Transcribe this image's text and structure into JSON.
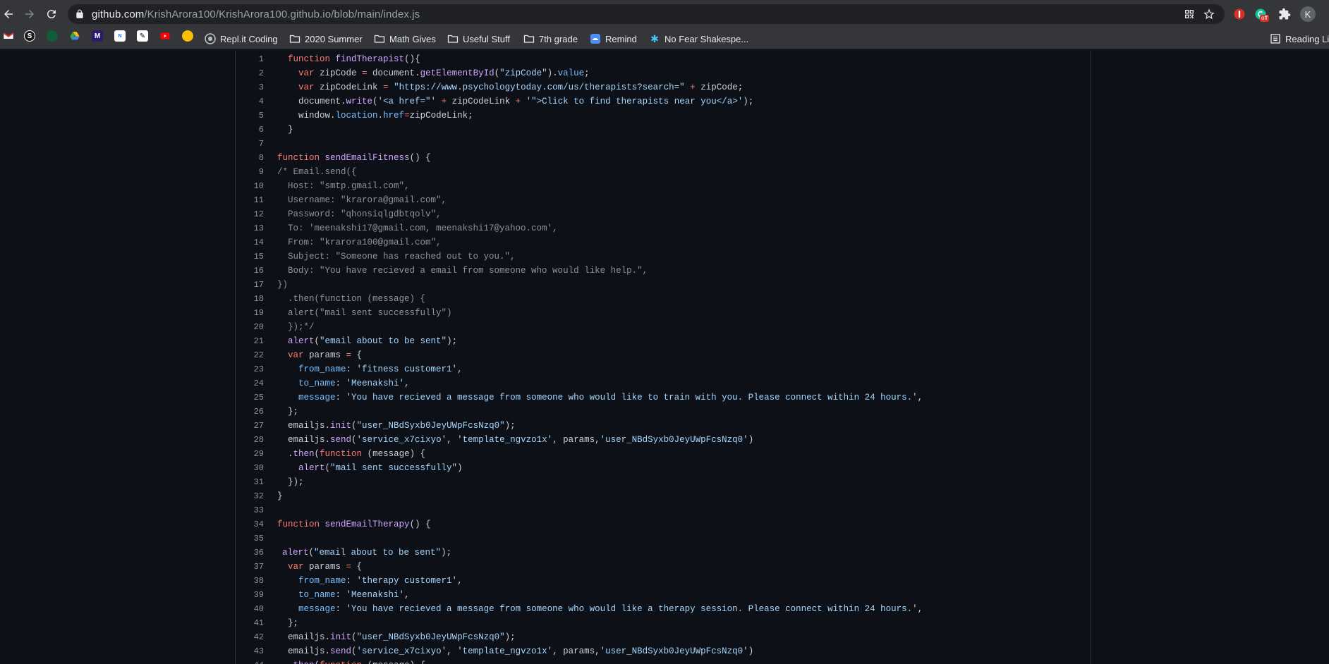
{
  "browser": {
    "url_host": "github.com",
    "url_path": "/KrishArora100/KrishArora100.github.io/blob/main/index.js",
    "profile_initial": "K",
    "extension_badge": "off",
    "bookmarks": [
      {
        "label": "Repl.it Coding",
        "icon": "replit-icon"
      },
      {
        "label": "2020 Summer",
        "icon": "folder-icon"
      },
      {
        "label": "Math Gives",
        "icon": "folder-icon"
      },
      {
        "label": "Useful Stuff",
        "icon": "folder-icon"
      },
      {
        "label": "7th grade",
        "icon": "folder-icon"
      },
      {
        "label": "Remind",
        "icon": "remind-icon"
      },
      {
        "label": "No Fear Shakespe...",
        "icon": "snowflake-icon"
      }
    ],
    "reading_list": "Reading Li"
  },
  "colors": {
    "keyword": "#ff7b72",
    "function": "#d2a8ff",
    "string": "#a5d6ff",
    "property": "#79c0ff",
    "comment": "#8b949e",
    "plain": "#c9d1d9"
  },
  "code": {
    "lines": [
      {
        "n": "1",
        "indent": 1,
        "tokens": [
          [
            "kw",
            "function"
          ],
          [
            "pl",
            " "
          ],
          [
            "fn",
            "findTherapist"
          ],
          [
            "pl",
            "(){"
          ]
        ]
      },
      {
        "n": "2",
        "indent": 2,
        "tokens": [
          [
            "kw",
            "var"
          ],
          [
            "pl",
            " zipCode "
          ],
          [
            "kw",
            "="
          ],
          [
            "pl",
            " document."
          ],
          [
            "fn",
            "getElementById"
          ],
          [
            "pl",
            "("
          ],
          [
            "str",
            "\"zipCode\""
          ],
          [
            "pl",
            ")."
          ],
          [
            "prop",
            "value"
          ],
          [
            "pl",
            ";"
          ]
        ]
      },
      {
        "n": "3",
        "indent": 2,
        "tokens": [
          [
            "kw",
            "var"
          ],
          [
            "pl",
            " zipCodeLink "
          ],
          [
            "kw",
            "="
          ],
          [
            "pl",
            " "
          ],
          [
            "str",
            "\"https://www.psychologytoday.com/us/therapists?search=\""
          ],
          [
            "pl",
            " "
          ],
          [
            "kw",
            "+"
          ],
          [
            "pl",
            " zipCode;"
          ]
        ]
      },
      {
        "n": "4",
        "indent": 2,
        "tokens": [
          [
            "pl",
            "document."
          ],
          [
            "fn",
            "write"
          ],
          [
            "pl",
            "("
          ],
          [
            "str",
            "'<a href=\"'"
          ],
          [
            "pl",
            " "
          ],
          [
            "kw",
            "+"
          ],
          [
            "pl",
            " zipCodeLink "
          ],
          [
            "kw",
            "+"
          ],
          [
            "pl",
            " "
          ],
          [
            "str",
            "'\">Click to find therapists near you</a>'"
          ],
          [
            "pl",
            ");"
          ]
        ]
      },
      {
        "n": "5",
        "indent": 2,
        "tokens": [
          [
            "pl",
            "window."
          ],
          [
            "prop",
            "location"
          ],
          [
            "pl",
            "."
          ],
          [
            "prop",
            "href"
          ],
          [
            "kw",
            "="
          ],
          [
            "pl",
            "zipCodeLink;"
          ]
        ]
      },
      {
        "n": "6",
        "indent": 1,
        "tokens": [
          [
            "pl",
            "}"
          ]
        ]
      },
      {
        "n": "7",
        "indent": 0,
        "tokens": []
      },
      {
        "n": "8",
        "indent": 0,
        "tokens": [
          [
            "kw",
            "function"
          ],
          [
            "pl",
            " "
          ],
          [
            "fn",
            "sendEmailFitness"
          ],
          [
            "pl",
            "() {"
          ]
        ]
      },
      {
        "n": "9",
        "indent": 0,
        "tokens": [
          [
            "cm",
            "/* Email.send({"
          ]
        ]
      },
      {
        "n": "10",
        "indent": 1,
        "tokens": [
          [
            "cm",
            "Host: \"smtp.gmail.com\","
          ]
        ]
      },
      {
        "n": "11",
        "indent": 1,
        "tokens": [
          [
            "cm",
            "Username: \"krarora@gmail.com\","
          ]
        ]
      },
      {
        "n": "12",
        "indent": 1,
        "tokens": [
          [
            "cm",
            "Password: \"qhonsiqlgdbtqolv\","
          ]
        ]
      },
      {
        "n": "13",
        "indent": 1,
        "tokens": [
          [
            "cm",
            "To: 'meenakshi17@gmail.com, meenakshi17@yahoo.com',"
          ]
        ]
      },
      {
        "n": "14",
        "indent": 1,
        "tokens": [
          [
            "cm",
            "From: \"krarora100@gmail.com\","
          ]
        ]
      },
      {
        "n": "15",
        "indent": 1,
        "tokens": [
          [
            "cm",
            "Subject: \"Someone has reached out to you.\","
          ]
        ]
      },
      {
        "n": "16",
        "indent": 1,
        "tokens": [
          [
            "cm",
            "Body: \"You have recieved a email from someone who would like help.\","
          ]
        ]
      },
      {
        "n": "17",
        "indent": 0,
        "tokens": [
          [
            "cm",
            "})"
          ]
        ]
      },
      {
        "n": "18",
        "indent": 1,
        "tokens": [
          [
            "cm",
            ".then(function (message) {"
          ]
        ]
      },
      {
        "n": "19",
        "indent": 1,
        "tokens": [
          [
            "cm",
            "alert(\"mail sent successfully\")"
          ]
        ]
      },
      {
        "n": "20",
        "indent": 1,
        "tokens": [
          [
            "cm",
            "});*/"
          ]
        ]
      },
      {
        "n": "21",
        "indent": 1,
        "tokens": [
          [
            "fn",
            "alert"
          ],
          [
            "pl",
            "("
          ],
          [
            "str",
            "\"email about to be sent\""
          ],
          [
            "pl",
            ");"
          ]
        ]
      },
      {
        "n": "22",
        "indent": 1,
        "tokens": [
          [
            "kw",
            "var"
          ],
          [
            "pl",
            " params "
          ],
          [
            "kw",
            "="
          ],
          [
            "pl",
            " {"
          ]
        ]
      },
      {
        "n": "23",
        "indent": 2,
        "tokens": [
          [
            "prop",
            "from_name"
          ],
          [
            "pl",
            ": "
          ],
          [
            "str",
            "'fitness customer1'"
          ],
          [
            "pl",
            ","
          ]
        ]
      },
      {
        "n": "24",
        "indent": 2,
        "tokens": [
          [
            "prop",
            "to_name"
          ],
          [
            "pl",
            ": "
          ],
          [
            "str",
            "'Meenakshi'"
          ],
          [
            "pl",
            ","
          ]
        ]
      },
      {
        "n": "25",
        "indent": 2,
        "tokens": [
          [
            "prop",
            "message"
          ],
          [
            "pl",
            ": "
          ],
          [
            "str",
            "'You have recieved a message from someone who would like to train with you. Please connect within 24 hours.'"
          ],
          [
            "pl",
            ","
          ]
        ]
      },
      {
        "n": "26",
        "indent": 1,
        "tokens": [
          [
            "pl",
            "};"
          ]
        ]
      },
      {
        "n": "27",
        "indent": 1,
        "tokens": [
          [
            "pl",
            "emailjs."
          ],
          [
            "fn",
            "init"
          ],
          [
            "pl",
            "("
          ],
          [
            "str",
            "\"user_NBdSyxb0JeyUWpFcsNzq0\""
          ],
          [
            "pl",
            ");"
          ]
        ]
      },
      {
        "n": "28",
        "indent": 1,
        "tokens": [
          [
            "pl",
            "emailjs."
          ],
          [
            "fn",
            "send"
          ],
          [
            "pl",
            "("
          ],
          [
            "str",
            "'service_x7cixyo'"
          ],
          [
            "pl",
            ", "
          ],
          [
            "str",
            "'template_ngvzo1x'"
          ],
          [
            "pl",
            ", params,"
          ],
          [
            "str",
            "'user_NBdSyxb0JeyUWpFcsNzq0'"
          ],
          [
            "pl",
            ")"
          ]
        ]
      },
      {
        "n": "29",
        "indent": 1,
        "tokens": [
          [
            "pl",
            "."
          ],
          [
            "fn",
            "then"
          ],
          [
            "pl",
            "("
          ],
          [
            "kw",
            "function"
          ],
          [
            "pl",
            " (message) {"
          ]
        ]
      },
      {
        "n": "30",
        "indent": 2,
        "tokens": [
          [
            "fn",
            "alert"
          ],
          [
            "pl",
            "("
          ],
          [
            "str",
            "\"mail sent successfully\""
          ],
          [
            "pl",
            ")"
          ]
        ]
      },
      {
        "n": "31",
        "indent": 1,
        "tokens": [
          [
            "pl",
            "});"
          ]
        ]
      },
      {
        "n": "32",
        "indent": 0,
        "tokens": [
          [
            "pl",
            "}"
          ]
        ]
      },
      {
        "n": "33",
        "indent": 0,
        "tokens": []
      },
      {
        "n": "34",
        "indent": 0,
        "tokens": [
          [
            "kw",
            "function"
          ],
          [
            "pl",
            " "
          ],
          [
            "fn",
            "sendEmailTherapy"
          ],
          [
            "pl",
            "() {"
          ]
        ]
      },
      {
        "n": "35",
        "indent": 0,
        "tokens": []
      },
      {
        "n": "36",
        "indent": 0,
        "pad": 1,
        "tokens": [
          [
            "fn",
            "alert"
          ],
          [
            "pl",
            "("
          ],
          [
            "str",
            "\"email about to be sent\""
          ],
          [
            "pl",
            ");"
          ]
        ]
      },
      {
        "n": "37",
        "indent": 1,
        "tokens": [
          [
            "kw",
            "var"
          ],
          [
            "pl",
            " params "
          ],
          [
            "kw",
            "="
          ],
          [
            "pl",
            " {"
          ]
        ]
      },
      {
        "n": "38",
        "indent": 2,
        "tokens": [
          [
            "prop",
            "from_name"
          ],
          [
            "pl",
            ": "
          ],
          [
            "str",
            "'therapy customer1'"
          ],
          [
            "pl",
            ","
          ]
        ]
      },
      {
        "n": "39",
        "indent": 2,
        "tokens": [
          [
            "prop",
            "to_name"
          ],
          [
            "pl",
            ": "
          ],
          [
            "str",
            "'Meenakshi'"
          ],
          [
            "pl",
            ","
          ]
        ]
      },
      {
        "n": "40",
        "indent": 2,
        "tokens": [
          [
            "prop",
            "message"
          ],
          [
            "pl",
            ": "
          ],
          [
            "str",
            "'You have recieved a message from someone who would like a therapy session. Please connect within 24 hours.'"
          ],
          [
            "pl",
            ","
          ]
        ]
      },
      {
        "n": "41",
        "indent": 1,
        "tokens": [
          [
            "pl",
            "};"
          ]
        ]
      },
      {
        "n": "42",
        "indent": 1,
        "tokens": [
          [
            "pl",
            "emailjs."
          ],
          [
            "fn",
            "init"
          ],
          [
            "pl",
            "("
          ],
          [
            "str",
            "\"user_NBdSyxb0JeyUWpFcsNzq0\""
          ],
          [
            "pl",
            ");"
          ]
        ]
      },
      {
        "n": "43",
        "indent": 1,
        "tokens": [
          [
            "pl",
            "emailjs."
          ],
          [
            "fn",
            "send"
          ],
          [
            "pl",
            "("
          ],
          [
            "str",
            "'service_x7cixyo'"
          ],
          [
            "pl",
            ", "
          ],
          [
            "str",
            "'template_ngvzo1x'"
          ],
          [
            "pl",
            ", params,"
          ],
          [
            "str",
            "'user_NBdSyxb0JeyUWpFcsNzq0'"
          ],
          [
            "pl",
            ")"
          ]
        ]
      },
      {
        "n": "44",
        "indent": 1,
        "tokens": [
          [
            "pl",
            "."
          ],
          [
            "fn",
            "then"
          ],
          [
            "pl",
            "("
          ],
          [
            "kw",
            "function"
          ],
          [
            "pl",
            " (message) {"
          ]
        ]
      }
    ]
  }
}
